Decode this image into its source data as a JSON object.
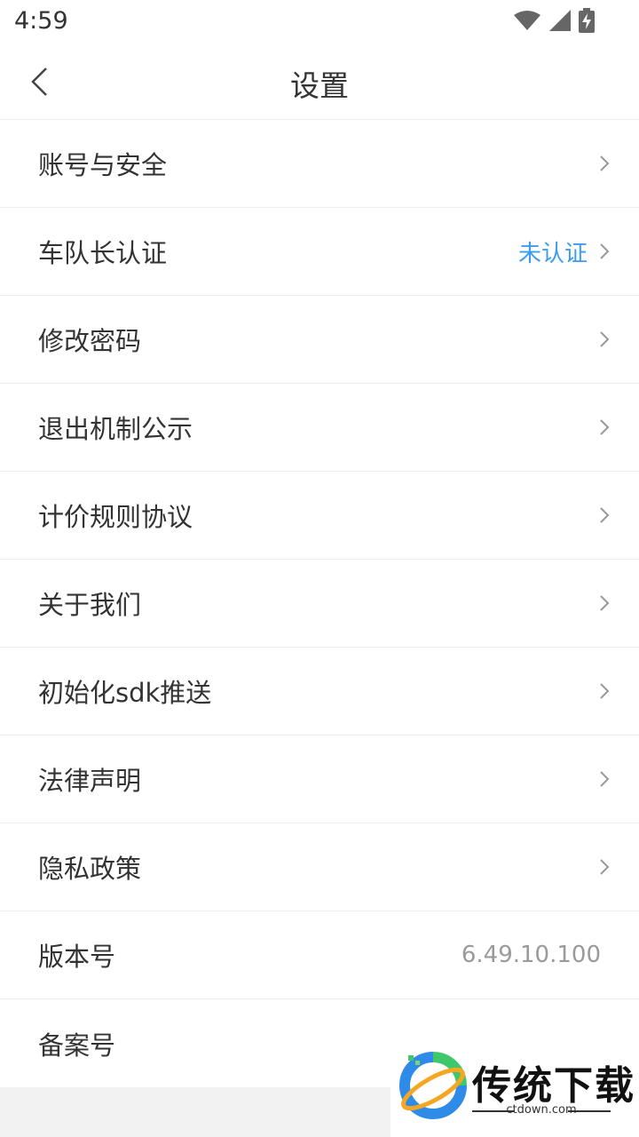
{
  "status_bar": {
    "time": "4:59"
  },
  "header": {
    "title": "设置"
  },
  "settings": [
    {
      "label": "账号与安全",
      "value": "",
      "chevron": true
    },
    {
      "label": "车队长认证",
      "value": "未认证",
      "chevron": true
    },
    {
      "label": "修改密码",
      "value": "",
      "chevron": true
    },
    {
      "label": "退出机制公示",
      "value": "",
      "chevron": true
    },
    {
      "label": "计价规则协议",
      "value": "",
      "chevron": true
    },
    {
      "label": "关于我们",
      "value": "",
      "chevron": true
    },
    {
      "label": "初始化sdk推送",
      "value": "",
      "chevron": true
    },
    {
      "label": "法律声明",
      "value": "",
      "chevron": true
    },
    {
      "label": "隐私政策",
      "value": "",
      "chevron": true
    },
    {
      "label": "版本号",
      "value": "6.49.10.100",
      "chevron": false
    },
    {
      "label": "备案号",
      "value": "",
      "chevron": false
    }
  ],
  "watermark": {
    "brand": "传统下载",
    "domain": "ctdown.com"
  },
  "colors": {
    "accent": "#3d9cf0",
    "muted": "#9a9a9a"
  }
}
